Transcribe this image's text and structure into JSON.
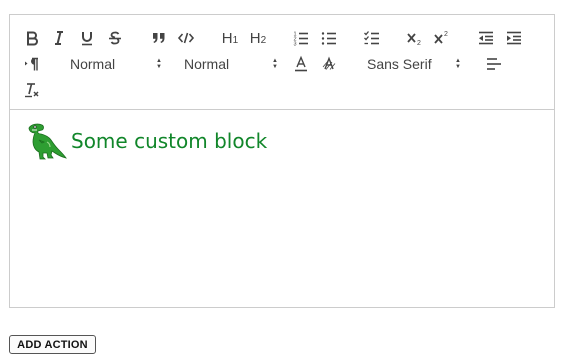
{
  "toolbar": {
    "header_1": {
      "label": "H",
      "sub": "1"
    },
    "header_2": {
      "label": "H",
      "sub": "2"
    },
    "size_picker": {
      "value": "Normal"
    },
    "header_picker": {
      "value": "Normal"
    },
    "font_picker": {
      "value": "Sans Serif"
    }
  },
  "editor": {
    "content": {
      "text": "Some custom block"
    }
  },
  "actions": {
    "add_action_label": "ADD ACTION"
  },
  "colors": {
    "custom_text": "#11862a",
    "border": "#cccccc",
    "icon": "#444444"
  },
  "icons": [
    "bold-icon",
    "italic-icon",
    "underline-icon",
    "strikethrough-icon",
    "blockquote-icon",
    "code-block-icon",
    "ordered-list-icon",
    "bullet-list-icon",
    "checklist-icon",
    "subscript-icon",
    "superscript-icon",
    "outdent-icon",
    "indent-icon",
    "direction-rtl-icon",
    "text-color-icon",
    "background-color-icon",
    "align-icon",
    "clear-format-icon",
    "dinosaur-icon"
  ]
}
